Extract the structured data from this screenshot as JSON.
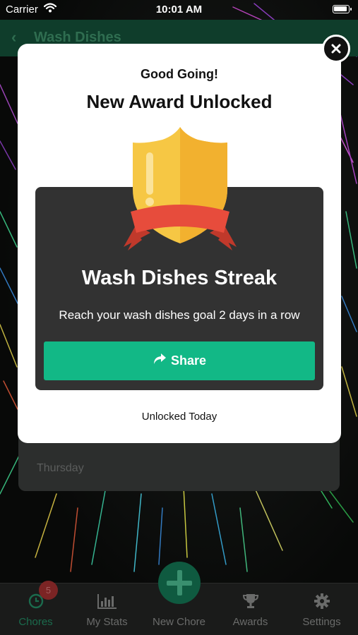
{
  "status_bar": {
    "carrier": "Carrier",
    "time": "10:01 AM"
  },
  "header": {
    "title": "Wash Dishes"
  },
  "background": {
    "day_label": "Thursday"
  },
  "modal": {
    "subtitle": "Good Going!",
    "title": "New Award Unlocked",
    "award_name": "Wash Dishes Streak",
    "award_description": "Reach your wash dishes goal 2 days in a row",
    "share_label": "Share",
    "unlocked_text": "Unlocked Today"
  },
  "tab_bar": {
    "tabs": [
      {
        "label": "Chores",
        "icon": "clock-icon",
        "badge": "5",
        "active": true
      },
      {
        "label": "My Stats",
        "icon": "bar-chart-icon"
      },
      {
        "label": "New Chore",
        "icon": "plus-icon"
      },
      {
        "label": "Awards",
        "icon": "trophy-icon"
      },
      {
        "label": "Settings",
        "icon": "gear-icon"
      }
    ]
  },
  "colors": {
    "accent": "#12b886",
    "card": "#323232",
    "header": "#0f3d2b",
    "badge": "#7b2424",
    "shield": "#f6c744",
    "ribbon": "#e74c3c"
  }
}
